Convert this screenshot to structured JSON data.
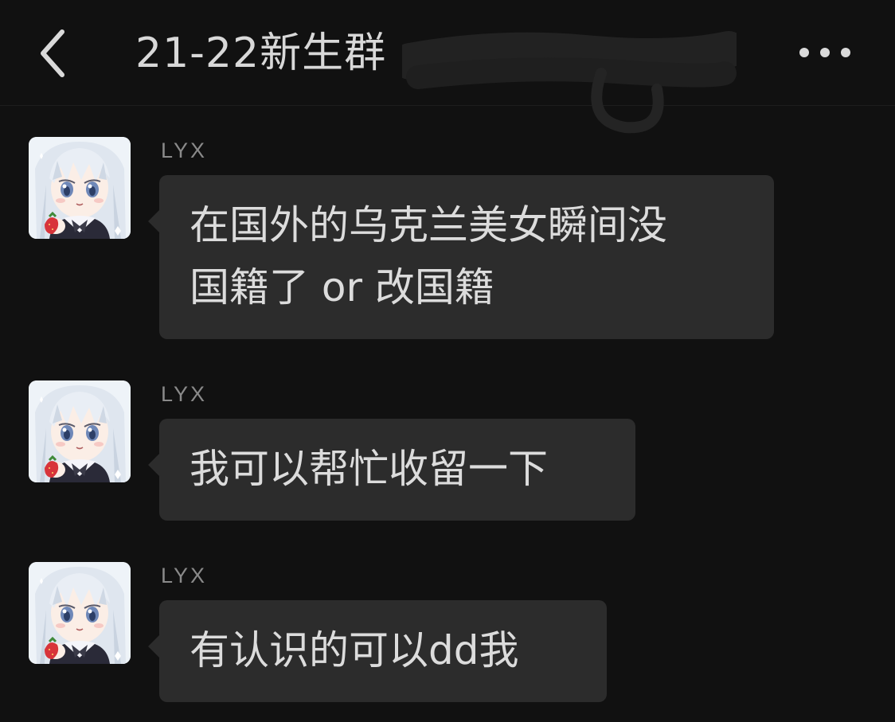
{
  "header": {
    "back_icon": "chevron-left-icon",
    "title": "21-22新生群",
    "more_icon": "more-horizontal-icon"
  },
  "messages": [
    {
      "sender": "LYX",
      "lines": [
        "在国外的乌克兰美女瞬间没",
        "国籍了 or 改国籍"
      ]
    },
    {
      "sender": "LYX",
      "lines": [
        "我可以帮忙收留一下"
      ]
    },
    {
      "sender": "LYX",
      "lines": [
        "有认识的可以dd我"
      ]
    }
  ],
  "colors": {
    "background": "#111111",
    "bubble": "#2c2c2c",
    "text": "#dcdcdc",
    "sender": "#8a8a8a"
  }
}
